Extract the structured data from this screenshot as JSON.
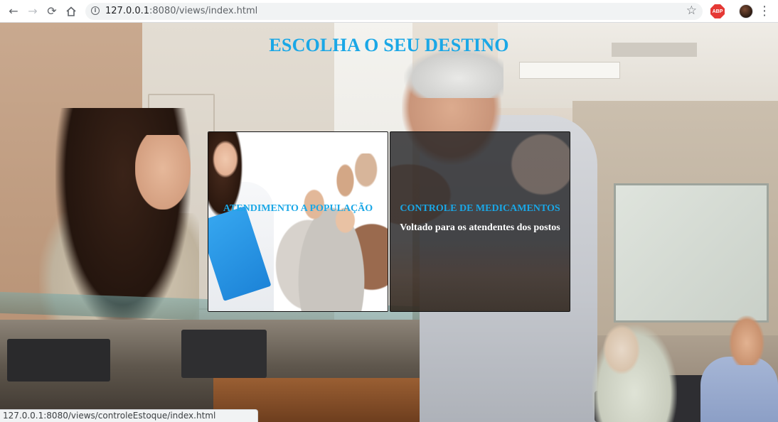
{
  "browser": {
    "back_icon": "arrow-left-icon",
    "forward_icon": "arrow-right-icon",
    "reload_icon": "reload-icon",
    "home_icon": "home-icon",
    "address_host": "127.0.0.1",
    "address_rest": ":8080/views/index.html",
    "bookmark_icon": "star-icon",
    "extension_label": "ABP",
    "menu_icon": "kebab-menu-icon"
  },
  "page": {
    "title": "ESCOLHA O SEU DESTINO",
    "cards": [
      {
        "title": "ATENDIMENTO A POPULAÇÃO",
        "subtitle": ""
      },
      {
        "title": "CONTROLE DE MEDICAMENTOS",
        "subtitle": "Voltado para os atendentes dos postos"
      }
    ]
  },
  "status_bar": {
    "hover_url": "127.0.0.1:8080/views/controleEstoque/index.html"
  },
  "colors": {
    "accent": "#1aa7e6",
    "card_dark_bg": "#1e1e20",
    "abp_red": "#e53935"
  }
}
